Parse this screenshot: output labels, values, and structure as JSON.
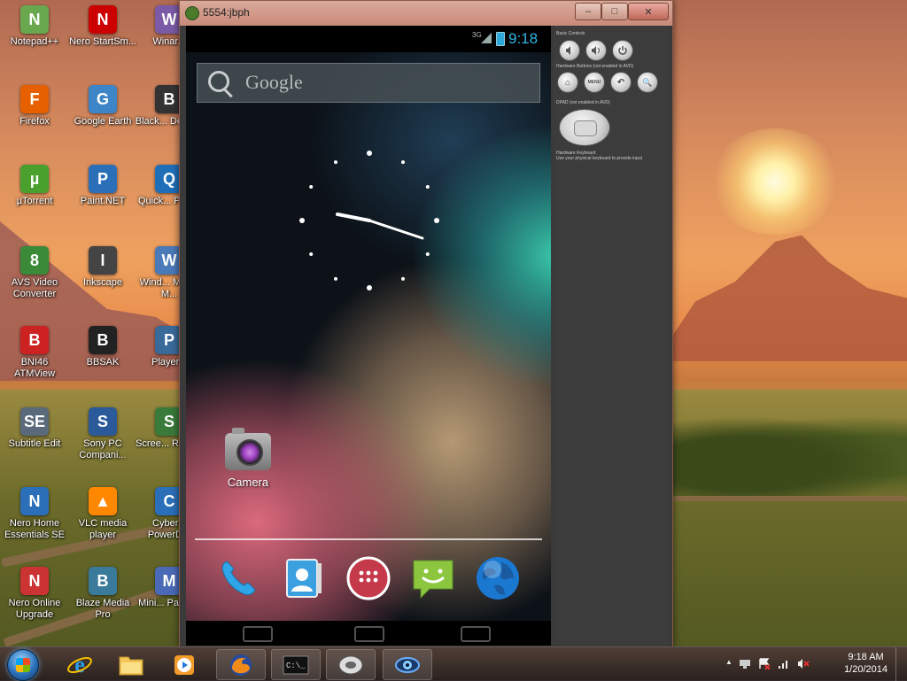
{
  "desktop": {
    "icons": [
      {
        "label": "Notepad++",
        "glyph": "N",
        "color": "#6aa84f"
      },
      {
        "label": "Nero StartSm...",
        "glyph": "N",
        "color": "#cc0000"
      },
      {
        "label": "Winar...",
        "glyph": "W",
        "color": "#7b5aa6"
      },
      {
        "label": "Firefox",
        "glyph": "F",
        "color": "#e66000"
      },
      {
        "label": "Google Earth",
        "glyph": "G",
        "color": "#3d85c6"
      },
      {
        "label": "Black... Deskt...",
        "glyph": "B",
        "color": "#333333"
      },
      {
        "label": "µTorrent",
        "glyph": "µ",
        "color": "#4aa02c"
      },
      {
        "label": "Paint.NET",
        "glyph": "P",
        "color": "#2a6fb8"
      },
      {
        "label": "Quick... Play...",
        "glyph": "Q",
        "color": "#1f6fb8"
      },
      {
        "label": "AVS Video Converter",
        "glyph": "8",
        "color": "#3a8a3a"
      },
      {
        "label": "Inkscape",
        "glyph": "I",
        "color": "#444444"
      },
      {
        "label": "Wind... Movie M...",
        "glyph": "W",
        "color": "#4a7ab8"
      },
      {
        "label": "BNI46 ATMView",
        "glyph": "B",
        "color": "#cc2222"
      },
      {
        "label": "BBSAK",
        "glyph": "B",
        "color": "#222222"
      },
      {
        "label": "Player...",
        "glyph": "P",
        "color": "#3a6a9a"
      },
      {
        "label": "Subtitle Edit",
        "glyph": "SE",
        "color": "#5a6a7a"
      },
      {
        "label": "Sony PC Compani...",
        "glyph": "S",
        "color": "#2a5a9a"
      },
      {
        "label": "Scree... Reco...",
        "glyph": "S",
        "color": "#3a7a3a"
      },
      {
        "label": "Nero Home Essentials SE",
        "glyph": "N",
        "color": "#2a6fb8"
      },
      {
        "label": "VLC media player",
        "glyph": "▲",
        "color": "#ff8800"
      },
      {
        "label": "Cyber... PowerD...",
        "glyph": "C",
        "color": "#2a6fb8"
      },
      {
        "label": "Nero Online Upgrade",
        "glyph": "N",
        "color": "#cc3333"
      },
      {
        "label": "Blaze Media Pro",
        "glyph": "B",
        "color": "#3a7a9a"
      },
      {
        "label": "Mini... Partiti...",
        "glyph": "M",
        "color": "#4a6ab8"
      }
    ]
  },
  "emulator": {
    "window_title": "5554:jbph",
    "window_buttons": [
      "–",
      "□",
      "✕"
    ],
    "statusbar": {
      "network": "3G",
      "time": "9:18"
    },
    "search_placeholder": "Google",
    "shortcut_label": "Camera",
    "dock_apps": [
      "phone",
      "contacts",
      "app-drawer",
      "messaging",
      "browser"
    ],
    "controls": {
      "basic_controls_label": "Basic Controls",
      "hardware_buttons_label": "Hardware Buttons (not enabled in AVD)",
      "hardware_buttons": [
        "⌂",
        "MENU",
        "↶",
        "🔍"
      ],
      "dpad_label": "DPAD (not enabled in AVD)",
      "keyboard_label": "Hardware Keyboard",
      "keyboard_hint": "Use your physical keyboard to provide input"
    }
  },
  "taskbar": {
    "tray_time": "9:18 AM",
    "tray_date": "1/20/2014"
  }
}
